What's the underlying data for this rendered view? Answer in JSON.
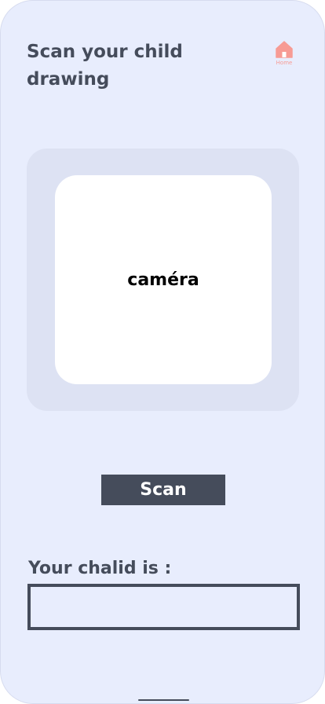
{
  "header": {
    "title": "Scan your child drawing",
    "home_label": "Home",
    "home_icon": "home-icon"
  },
  "camera": {
    "label": "caméra"
  },
  "actions": {
    "scan_label": "Scan"
  },
  "result": {
    "label": "Your chalid is :",
    "value": ""
  },
  "colors": {
    "background": "#e8edfd",
    "frame": "#dde2f3",
    "primary": "#454c5b",
    "home_icon": "#f79b94"
  }
}
